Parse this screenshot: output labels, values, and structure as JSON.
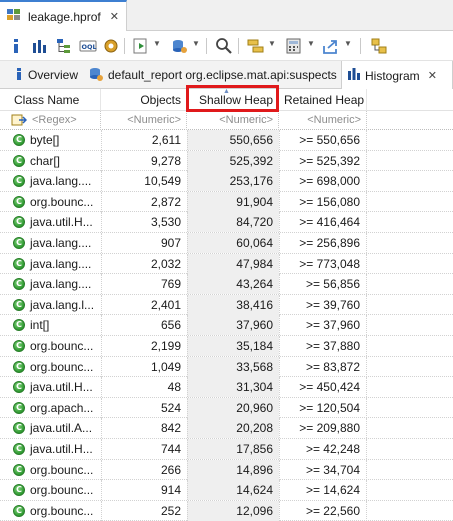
{
  "editor_tab": {
    "title": "leakage.hprof",
    "close_glyph": "✕"
  },
  "toolbar": {
    "icons": [
      "info-icon",
      "histogram-icon",
      "dominator-tree-icon",
      "oql-icon",
      "heap-dump-overview-icon",
      "run-expert-report-icon",
      "query-browser-icon",
      "search-icon",
      "group-by-icon",
      "calculate-retained-icon",
      "export-icon",
      "pin-icon"
    ]
  },
  "view_tabs": [
    {
      "label": "Overview",
      "icon": "info-icon"
    },
    {
      "label": "default_report  org.eclipse.mat.api:suspects",
      "icon": "report-icon"
    },
    {
      "label": "Histogram",
      "icon": "histogram-icon",
      "close_glyph": "✕"
    }
  ],
  "columns": [
    "Class Name",
    "Objects",
    "Shallow Heap",
    "Retained Heap"
  ],
  "sorted_column": "Shallow Heap",
  "filters": [
    "<Regex>",
    "<Numeric>",
    "<Numeric>",
    "<Numeric>"
  ],
  "rows": [
    {
      "name": "byte[]",
      "objects": "2,611",
      "shallow": "550,656",
      "retained": ">= 550,656"
    },
    {
      "name": "char[]",
      "objects": "9,278",
      "shallow": "525,392",
      "retained": ">= 525,392"
    },
    {
      "name": "java.lang....",
      "objects": "10,549",
      "shallow": "253,176",
      "retained": ">= 698,000"
    },
    {
      "name": "org.bounc...",
      "objects": "2,872",
      "shallow": "91,904",
      "retained": ">= 156,080"
    },
    {
      "name": "java.util.H...",
      "objects": "3,530",
      "shallow": "84,720",
      "retained": ">= 416,464"
    },
    {
      "name": "java.lang....",
      "objects": "907",
      "shallow": "60,064",
      "retained": ">= 256,896"
    },
    {
      "name": "java.lang....",
      "objects": "2,032",
      "shallow": "47,984",
      "retained": ">= 773,048"
    },
    {
      "name": "java.lang....",
      "objects": "769",
      "shallow": "43,264",
      "retained": ">= 56,856"
    },
    {
      "name": "java.lang.l...",
      "objects": "2,401",
      "shallow": "38,416",
      "retained": ">= 39,760"
    },
    {
      "name": "int[]",
      "objects": "656",
      "shallow": "37,960",
      "retained": ">= 37,960"
    },
    {
      "name": "org.bounc...",
      "objects": "2,199",
      "shallow": "35,184",
      "retained": ">= 37,880"
    },
    {
      "name": "org.bounc...",
      "objects": "1,049",
      "shallow": "33,568",
      "retained": ">= 83,872"
    },
    {
      "name": "java.util.H...",
      "objects": "48",
      "shallow": "31,304",
      "retained": ">= 450,424"
    },
    {
      "name": "org.apach...",
      "objects": "524",
      "shallow": "20,960",
      "retained": ">= 120,504"
    },
    {
      "name": "java.util.A...",
      "objects": "842",
      "shallow": "20,208",
      "retained": ">= 209,880"
    },
    {
      "name": "java.util.H...",
      "objects": "744",
      "shallow": "17,856",
      "retained": ">= 42,248"
    },
    {
      "name": "org.bounc...",
      "objects": "266",
      "shallow": "14,896",
      "retained": ">= 34,704"
    },
    {
      "name": "org.bounc...",
      "objects": "914",
      "shallow": "14,624",
      "retained": ">= 14,624"
    },
    {
      "name": "org.bounc...",
      "objects": "252",
      "shallow": "12,096",
      "retained": ">= 22,560"
    }
  ],
  "class_icon_letter": "C",
  "colors": {
    "highlight_border": "#e0191b",
    "sorted_column_bg": "#efefef",
    "class_icon": "#2f9a31"
  }
}
